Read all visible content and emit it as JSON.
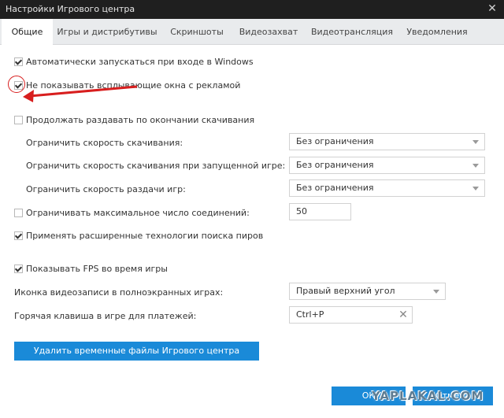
{
  "window": {
    "title": "Настройки Игрового центра"
  },
  "tabs": [
    {
      "label": "Общие",
      "active": true
    },
    {
      "label": "Игры и дистрибутивы",
      "active": false
    },
    {
      "label": "Скриншоты",
      "active": false
    },
    {
      "label": "Видеозахват",
      "active": false
    },
    {
      "label": "Видеотрансляция",
      "active": false
    },
    {
      "label": "Уведомления",
      "active": false
    }
  ],
  "settings": {
    "autostart": {
      "label": "Автоматически запускаться при входе в Windows",
      "checked": true
    },
    "no_ads": {
      "label": "Не показывать всплывающие окна с рекламой",
      "checked": true
    },
    "keep_seeding": {
      "label": "Продолжать раздавать по окончании скачивания",
      "checked": false
    },
    "download_limit": {
      "label": "Ограничить скорость скачивания:",
      "value": "Без ограничения"
    },
    "download_limit_ingame": {
      "label": "Ограничить скорость скачивания при запущенной игре:",
      "value": "Без ограничения"
    },
    "upload_limit": {
      "label": "Ограничить скорость раздачи игр:",
      "value": "Без ограничения"
    },
    "max_connections": {
      "label": "Ограничивать максимальное число соединений:",
      "checked": false,
      "value": "50"
    },
    "peer_search": {
      "label": "Применять расширенные технологии поиска пиров",
      "checked": true
    },
    "show_fps": {
      "label": "Показывать FPS во время игры",
      "checked": true
    },
    "record_icon": {
      "label": "Иконка видеозаписи в полноэкранных играх:",
      "value": "Правый верхний угол"
    },
    "payment_hotkey": {
      "label": "Горячая клавиша в игре для платежей:",
      "value": "Ctrl+P"
    }
  },
  "buttons": {
    "delete_temp": "Удалить временные файлы Игрового центра",
    "ok": "ОК",
    "cancel": "Отмена"
  },
  "watermark": "YAPLAKAL.COM",
  "colors": {
    "accent": "#1a8ad8",
    "titlebar": "#1f1f1f",
    "annotation": "#d81e1e"
  }
}
